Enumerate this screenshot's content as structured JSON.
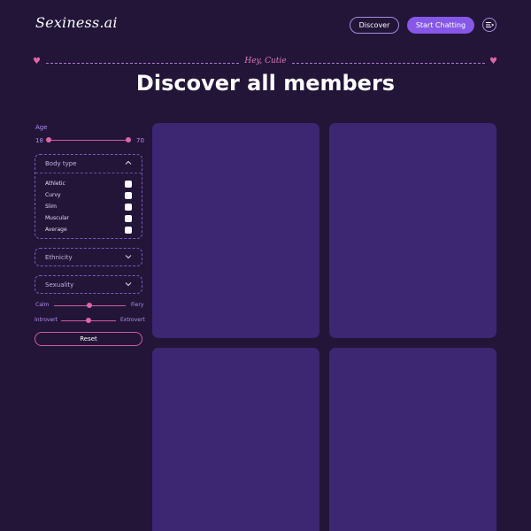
{
  "header": {
    "logo_text": "Sexiness.ai",
    "discover_label": "Discover",
    "start_chatting_label": "Start Chatting",
    "menu_icon": "menu-icon"
  },
  "hero": {
    "tagline": "Hey, Cutie",
    "title": "Discover all members"
  },
  "filters": {
    "age": {
      "label": "Age",
      "min": "18",
      "max": "70"
    },
    "body_type": {
      "title": "Body type",
      "options": [
        "Athletic",
        "Curvy",
        "Slim",
        "Muscular",
        "Average"
      ]
    },
    "ethnicity": {
      "title": "Ethnicity"
    },
    "sexuality": {
      "title": "Sexuality"
    },
    "temperament": {
      "left": "Calm",
      "right": "Fiery"
    },
    "personality": {
      "left": "Introvert",
      "right": "Extrovert"
    },
    "reset_label": "Reset"
  },
  "colors": {
    "background": "#221538",
    "accent": "#8757ea",
    "pink": "#e064a8",
    "card": "#3d2672"
  }
}
